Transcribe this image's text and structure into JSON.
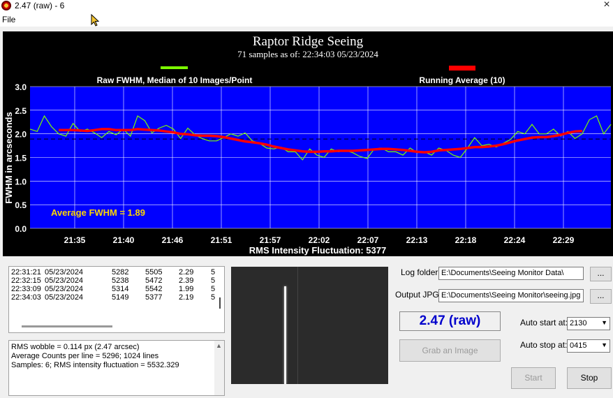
{
  "window": {
    "title": "2.47 (raw) -  6"
  },
  "menu": {
    "file": "File"
  },
  "chart_data": {
    "type": "line",
    "title": "Raptor Ridge Seeing",
    "subtitle": "71 samples as of: 22:34:03 05/23/2024",
    "legend": [
      "Raw FWHM, Median of 10 Images/Point",
      "Running Average (10)"
    ],
    "legend_colors": [
      "#7cfc00",
      "#ff0000"
    ],
    "ylabel": "FWHM in arcseconds",
    "xlabel": "RMS Intensity Fluctuation: 5377",
    "annotation": "Average FWHM = 1.89",
    "average": 1.89,
    "ylim": [
      0,
      3
    ],
    "yticks": [
      "0.0",
      "0.5",
      "1.0",
      "1.5",
      "2.0",
      "2.5",
      "3.0"
    ],
    "xticks": [
      "21:35",
      "21:40",
      "21:46",
      "21:51",
      "21:57",
      "22:02",
      "22:07",
      "22:13",
      "22:18",
      "22:24",
      "22:29"
    ],
    "grid": true,
    "background": "#0000ff",
    "series": [
      {
        "name": "Raw FWHM, Median of 10 Images/Point",
        "color": "#7cfc00",
        "values": [
          2.1,
          2.05,
          2.38,
          2.15,
          2.0,
          1.95,
          2.22,
          2.05,
          2.1,
          2.02,
          1.92,
          2.05,
          1.98,
          2.1,
          1.95,
          2.38,
          2.28,
          2.02,
          2.12,
          2.18,
          2.1,
          1.9,
          2.12,
          1.98,
          1.9,
          1.85,
          1.85,
          1.92,
          2.0,
          1.95,
          2.02,
          1.85,
          1.8,
          1.7,
          1.68,
          1.72,
          1.62,
          1.62,
          1.45,
          1.68,
          1.55,
          1.5,
          1.68,
          1.62,
          1.65,
          1.6,
          1.52,
          1.48,
          1.68,
          1.7,
          1.62,
          1.62,
          1.55,
          1.7,
          1.6,
          1.62,
          1.55,
          1.7,
          1.65,
          1.55,
          1.5,
          1.7,
          1.92,
          1.75,
          1.78,
          1.72,
          1.8,
          1.88,
          2.05,
          2.0,
          2.2,
          2.0,
          2.0,
          2.1,
          1.95,
          2.05,
          1.9,
          2.0,
          2.3,
          2.38,
          2.0,
          2.2
        ]
      },
      {
        "name": "Running Average (10)",
        "color": "#ff0000",
        "x_start_index": 4,
        "values": [
          2.08,
          2.08,
          2.08,
          2.07,
          2.06,
          2.08,
          2.1,
          2.1,
          2.08,
          2.08,
          2.08,
          2.1,
          2.09,
          2.08,
          2.07,
          2.05,
          2.03,
          2.0,
          1.99,
          1.97,
          1.96,
          1.96,
          1.95,
          1.93,
          1.9,
          1.87,
          1.84,
          1.82,
          1.8,
          1.77,
          1.73,
          1.7,
          1.67,
          1.65,
          1.63,
          1.62,
          1.62,
          1.63,
          1.63,
          1.64,
          1.64,
          1.64,
          1.65,
          1.66,
          1.67,
          1.68,
          1.68,
          1.67,
          1.66,
          1.64,
          1.62,
          1.61,
          1.62,
          1.65,
          1.66,
          1.67,
          1.68,
          1.7,
          1.72,
          1.72,
          1.73,
          1.75,
          1.78,
          1.82,
          1.86,
          1.89,
          1.92,
          1.93,
          1.93,
          1.95,
          1.98,
          2.02,
          2.05,
          2.06
        ]
      }
    ]
  },
  "log": {
    "rows": [
      {
        "time": "22:31:21",
        "date": "05/23/2024",
        "v1": "5282",
        "v2": "5505",
        "v3": "2.29",
        "v4": "5"
      },
      {
        "time": "22:32:15",
        "date": "05/23/2024",
        "v1": "5238",
        "v2": "5472",
        "v3": "2.39",
        "v4": "5"
      },
      {
        "time": "22:33:09",
        "date": "05/23/2024",
        "v1": "5314",
        "v2": "5542",
        "v3": "1.99",
        "v4": "5"
      },
      {
        "time": "22:34:03",
        "date": "05/23/2024",
        "v1": "5149",
        "v2": "5377",
        "v3": "2.19",
        "v4": "5"
      }
    ]
  },
  "status": {
    "lines": [
      "RMS wobble = 0.114 px (2.47 arcsec)",
      "Average Counts per line = 5296; 1024 lines",
      "Samples:  6; RMS intensity fluctuation =  5532.329"
    ]
  },
  "settings": {
    "log_folder_label": "Log folder",
    "log_folder_value": "E:\\Documents\\Seeing Monitor Data\\",
    "output_jpg_label": "Output JPG",
    "output_jpg_value": "E:\\Documents\\Seeing Monitor\\seeing.jpg",
    "browse_label": "...",
    "fwhm_value": "2.47 (raw)",
    "grab_label": "Grab an Image",
    "auto_start_label": "Auto start at:",
    "auto_start_value": "2130",
    "auto_stop_label": "Auto stop at:",
    "auto_stop_value": "0415",
    "start_label": "Start",
    "stop_label": "Stop"
  }
}
